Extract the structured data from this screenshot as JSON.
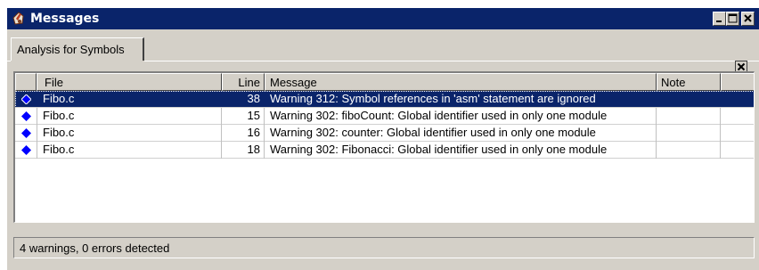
{
  "window": {
    "title": "Messages"
  },
  "tabs": [
    {
      "label": "Analysis for Symbols",
      "active": true
    }
  ],
  "table": {
    "columns": {
      "file": "File",
      "line": "Line",
      "message": "Message",
      "note": "Note"
    },
    "rows": [
      {
        "file": "Fibo.c",
        "line": "38",
        "message": "Warning 312: Symbol references in 'asm' statement are ignored",
        "note": "",
        "selected": true
      },
      {
        "file": "Fibo.c",
        "line": "15",
        "message": "Warning 302: fiboCount: Global identifier used in only one module",
        "note": ""
      },
      {
        "file": "Fibo.c",
        "line": "16",
        "message": "Warning 302: counter: Global identifier used in only one module",
        "note": ""
      },
      {
        "file": "Fibo.c",
        "line": "18",
        "message": "Warning 302: Fibonacci: Global identifier used in only one module",
        "note": ""
      }
    ]
  },
  "status": {
    "text": "4 warnings, 0 errors detected"
  },
  "colors": {
    "title_bar": "#0a246a",
    "selection": "#0a246a",
    "face": "#d4d0c8",
    "warning_icon": "#0000ff"
  },
  "icons": [
    "app-icon",
    "minimize-icon",
    "maximize-icon",
    "close-icon",
    "pane-close-icon",
    "warning-diamond-icon"
  ]
}
